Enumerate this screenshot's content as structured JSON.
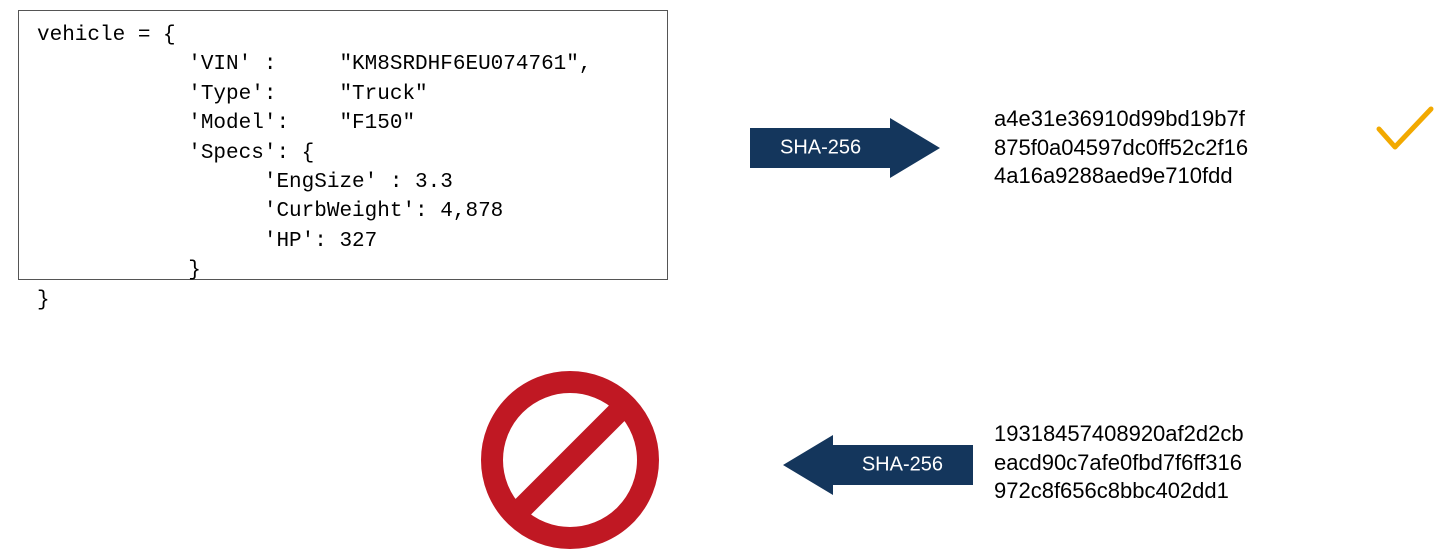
{
  "code_block": "vehicle = {\n            'VIN' :     \"KM8SRDHF6EU074761\",\n            'Type':     \"Truck\"\n            'Model':    \"F150\"\n            'Specs': {\n                  'EngSize' : 3.3\n                  'CurbWeight': 4,878\n                  'HP': 327\n            }\n}",
  "arrow1_label": "SHA-256",
  "arrow2_label": "SHA-256",
  "hash1": "a4e31e36910d99bd19b7f\n875f0a04597dc0ff52c2f16\n4a16a9288aed9e710fdd",
  "hash2": "19318457408920af2d2cb\neacd90c7afe0fbd7f6ff316\n972c8f656c8bbc402dd1",
  "colors": {
    "arrow_fill": "#14365c",
    "prohibit": "#c01823",
    "check": "#f2a900"
  }
}
